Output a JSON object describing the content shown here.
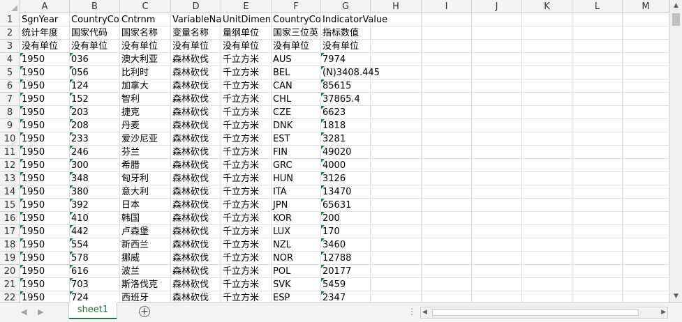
{
  "columns": [
    "A",
    "B",
    "C",
    "D",
    "E",
    "F",
    "G",
    "H",
    "I",
    "J",
    "K",
    "L",
    "M"
  ],
  "row_numbers": [
    "1",
    "2",
    "3",
    "4",
    "5",
    "6",
    "7",
    "8",
    "9",
    "10",
    "11",
    "12",
    "13",
    "14",
    "15",
    "16",
    "17",
    "18",
    "19",
    "20",
    "21",
    "22"
  ],
  "rows": [
    [
      "SgnYear",
      "CountryCo",
      "Cntrnm",
      "VariableNa",
      "UnitDimen",
      "CountryCo",
      "IndicatorValue"
    ],
    [
      "统计年度",
      "国家代码",
      "国家名称",
      "变量名称",
      "量纲单位",
      "国家三位英",
      "指标数值"
    ],
    [
      "没有单位",
      "没有单位",
      "没有单位",
      "没有单位",
      "没有单位",
      "没有单位",
      "没有单位"
    ],
    [
      "1950",
      "036",
      "澳大利亚",
      "森林砍伐",
      "千立方米",
      "AUS",
      "7974"
    ],
    [
      "1950",
      "056",
      "比利时",
      "森林砍伐",
      "千立方米",
      "BEL",
      "(N)3408.445"
    ],
    [
      "1950",
      "124",
      "加拿大",
      "森林砍伐",
      "千立方米",
      "CAN",
      "85615"
    ],
    [
      "1950",
      "152",
      "智利",
      "森林砍伐",
      "千立方米",
      "CHL",
      "37865.4"
    ],
    [
      "1950",
      "203",
      "捷克",
      "森林砍伐",
      "千立方米",
      "CZE",
      "6623"
    ],
    [
      "1950",
      "208",
      "丹麦",
      "森林砍伐",
      "千立方米",
      "DNK",
      "1818"
    ],
    [
      "1950",
      "233",
      "爱沙尼亚",
      "森林砍伐",
      "千立方米",
      "EST",
      "3281"
    ],
    [
      "1950",
      "246",
      "芬兰",
      "森林砍伐",
      "千立方米",
      "FIN",
      "49020"
    ],
    [
      "1950",
      "300",
      "希腊",
      "森林砍伐",
      "千立方米",
      "GRC",
      "4000"
    ],
    [
      "1950",
      "348",
      "匈牙利",
      "森林砍伐",
      "千立方米",
      "HUN",
      "3126"
    ],
    [
      "1950",
      "380",
      "意大利",
      "森林砍伐",
      "千立方米",
      "ITA",
      "13470"
    ],
    [
      "1950",
      "392",
      "日本",
      "森林砍伐",
      "千立方米",
      "JPN",
      "65631"
    ],
    [
      "1950",
      "410",
      "韩国",
      "森林砍伐",
      "千立方米",
      "KOR",
      "200"
    ],
    [
      "1950",
      "442",
      "卢森堡",
      "森林砍伐",
      "千立方米",
      "LUX",
      "170"
    ],
    [
      "1950",
      "554",
      "新西兰",
      "森林砍伐",
      "千立方米",
      "NZL",
      "3460"
    ],
    [
      "1950",
      "578",
      "挪威",
      "森林砍伐",
      "千立方米",
      "NOR",
      "12788"
    ],
    [
      "1950",
      "616",
      "波兰",
      "森林砍伐",
      "千立方米",
      "POL",
      "20177"
    ],
    [
      "1950",
      "703",
      "斯洛伐克",
      "森林砍伐",
      "千立方米",
      "SVK",
      "5459"
    ],
    [
      "1950",
      "724",
      "西班牙",
      "森林砍伐",
      "千立方米",
      "ESP",
      "2347"
    ]
  ],
  "text_number_indicator_columns": [
    0,
    1,
    6
  ],
  "sheet_tab": "sheet1",
  "add_sheet_icon": "plus-circle-icon",
  "colors": {
    "accent": "#217346",
    "error_indicator": "#1e7e34",
    "header_bg": "#f3f3f3",
    "gridline": "#e1e1e1"
  }
}
